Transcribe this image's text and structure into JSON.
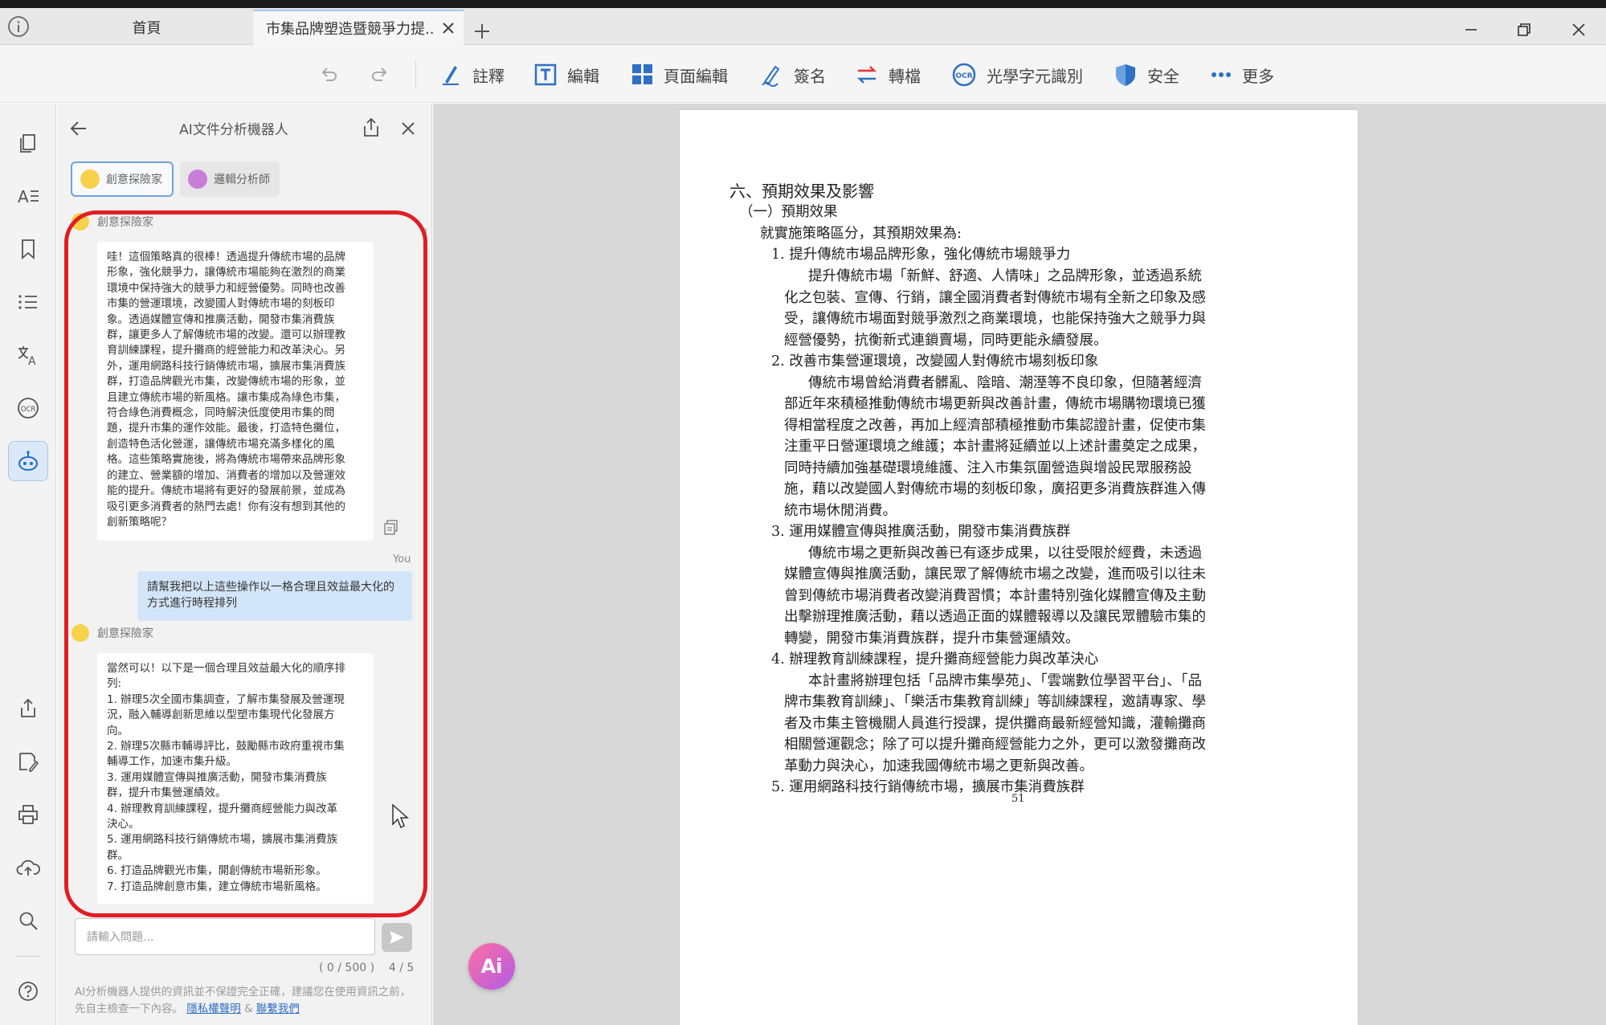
{
  "tabs": {
    "home_label": "首頁",
    "doc_label": "市集品牌塑造暨競爭力提..."
  },
  "toolbar": {
    "annotate": "註釋",
    "edit": "編輯",
    "page_edit": "頁面編輯",
    "sign": "簽名",
    "convert": "轉檔",
    "ocr": "光學字元識別",
    "security": "安全",
    "more": "更多"
  },
  "panel": {
    "title": "AI文件分析機器人",
    "persona_creative": "創意探險家",
    "persona_logic": "邏輯分析師",
    "messages": [
      {
        "speaker": "創意探險家",
        "lines": [
          "哇！這個策略真的很棒！透過提升傳統市場的品牌",
          "形象，強化競爭力，讓傳統市場能夠在激烈的商業",
          "環境中保持強大的競爭力和經營優勢。同時也改善",
          "市集的營運環境，改變國人對傳統市場的刻板印",
          "象。透過媒體宣傳和推廣活動，開發市集消費族",
          "群，讓更多人了解傳統市場的改變。還可以辦理教",
          "育訓練課程，提升攤商的經營能力和改革決心。另",
          "外，運用網路科技行銷傳統市場，擴展市集消費族",
          "群，打造品牌觀光市集，改變傳統市場的形象，並",
          "且建立傳統市場的新風格。讓市集成為綠色市集，",
          "符合綠色消費概念，同時解決低度使用市集的問",
          "題，提升市集的運作效能。最後，打造特色攤位，",
          "創造特色活化營運，讓傳統市場充滿多樣化的風",
          "格。這些策略實施後，將為傳統市場帶來品牌形象",
          "的建立、營業額的增加、消費者的增加以及營運效",
          "能的提升。傳統市場將有更好的發展前景，並成為",
          "吸引更多消費者的熱門去處！你有沒有想到其他的",
          "創新策略呢？"
        ]
      },
      {
        "speaker": "You",
        "lines": [
          "請幫我把以上這些操作以一格合理且效益最大化的",
          "方式進行時程排列"
        ]
      },
      {
        "speaker": "創意探險家",
        "lines": [
          "當然可以！以下是一個合理且效益最大化的順序排",
          "列:",
          "1. 辦理5次全國市集調查，了解市集發展及營運現",
          "況，融入輔導創新思維以型塑市集現代化發展方",
          "向。",
          "2. 辦理5次縣市輔導評比，鼓勵縣市政府重視市集",
          "輔導工作，加速市集升級。",
          "3. 運用媒體宣傳與推廣活動，開發市集消費族",
          "群，提升市集營運績效。",
          "4. 辦理教育訓練課程，提升攤商經營能力與改革",
          "決心。",
          "5. 運用網路科技行銷傳統市場，擴展市集消費族",
          "群。",
          "6. 打造品牌觀光市集，開創傳統市場新形象。",
          "7. 打造品牌創意市集，建立傳統市場新風格。"
        ]
      }
    ],
    "input_placeholder": "請輸入問題...",
    "char_counter": "( 0 / 500 )",
    "page_counter": "4 / 5",
    "disclaimer_text": "AI分析機器人提供的資訊並不保證完全正確，建議您在使用資訊之前，先自主檢查一下內容。",
    "privacy_link": "隱私權聲明",
    "ampersand": "&",
    "contact_link": "聯繫我們"
  },
  "document": {
    "lines": [
      "六、預期效果及影響",
      "（一）預期效果",
      "就實施策略區分，其預期效果為:",
      "1. 提升傳統市場品牌形象，強化傳統市場競爭力",
      "提升傳統市場「新鮮、舒適、人情味」之品牌形象，並透過系統",
      "化之包裝、宣傳、行銷，讓全國消費者對傳統市場有全新之印象及感",
      "受，讓傳統市場面對競爭激烈之商業環境，也能保持強大之競爭力與",
      "經營優勢，抗衡新式連鎖賣場，同時更能永續發展。",
      "2. 改善市集營運環境，改變國人對傳統市場刻板印象",
      "傳統市場曾給消費者髒亂、陰暗、潮溼等不良印象，但隨著經濟",
      "部近年來積極推動傳統市場更新與改善計畫，傳統市場購物環境已獲",
      "得相當程度之改善，再加上經濟部積極推動市集認證計畫，促使市集",
      "注重平日營運環境之維護；本計畫將延續並以上述計畫奠定之成果，",
      "同時持續加強基礎環境維護、注入市集氛圍營造與增設民眾服務設",
      "施，藉以改變國人對傳統市場的刻板印象，廣招更多消費族群進入傳",
      "統市場休閒消費。",
      "3. 運用媒體宣傳與推廣活動，開發市集消費族群",
      "傳統市場之更新與改善已有逐步成果，以往受限於經費，未透過",
      "媒體宣傳與推廣活動，讓民眾了解傳統市場之改變，進而吸引以往未",
      "曾到傳統市場消費者改變消費習慣；本計畫特別強化媒體宣傳及主動",
      "出擊辦理推廣活動，藉以透過正面的媒體報導以及讓民眾體驗市集的",
      "轉變，開發市集消費族群，提升市集營運績效。",
      "4. 辦理教育訓練課程，提升攤商經營能力與改革決心",
      "本計畫將辦理包括「品牌市集學苑」、「雲端數位學習平台」、「品",
      "牌市集教育訓練」、「樂活市集教育訓練」等訓練課程，邀請專家、學",
      "者及市集主管機關人員進行授課，提供攤商最新經營知識，灌輸攤商",
      "相關營運觀念；除了可以提升攤商經營能力之外，更可以激發攤商改",
      "革動力與決心，加速我國傳統市場之更新與改善。",
      "5. 運用網路科技行銷傳統市場，擴展市集消費族群"
    ],
    "page_number": "51"
  },
  "fab_label": "Ai"
}
